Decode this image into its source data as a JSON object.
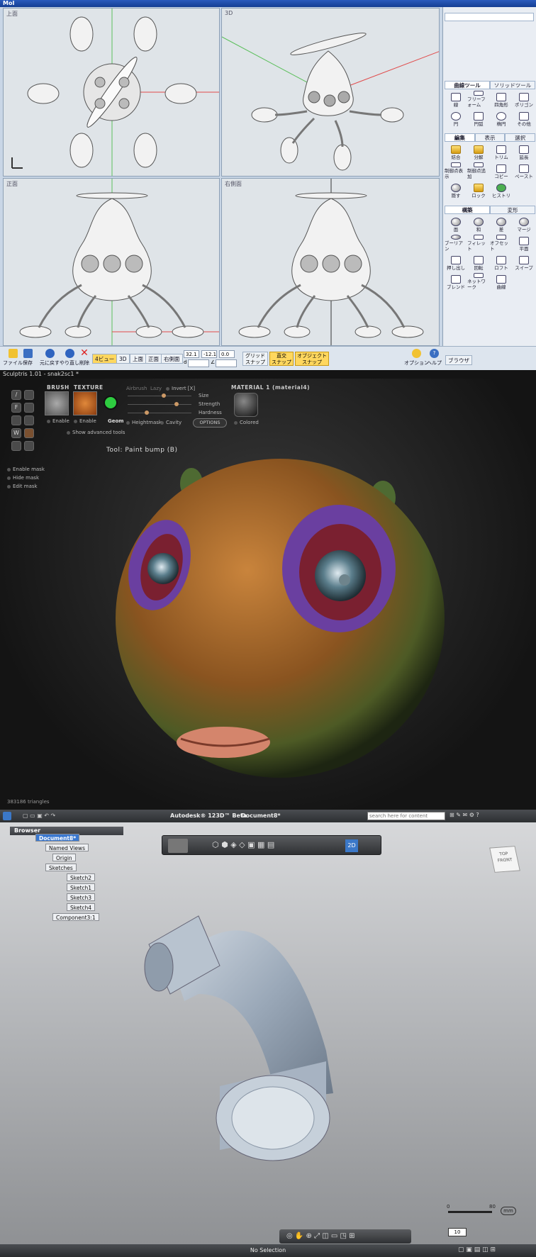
{
  "moi": {
    "title": "MoI",
    "viewports": {
      "top": "上面",
      "3d": "3D",
      "front": "正面",
      "right": "右側面"
    },
    "panel": {
      "tabs1": [
        "曲線ツール",
        "ソリッドツール"
      ],
      "curve_tools": [
        "線",
        "フリーフォーム",
        "四角形",
        "ポリゴン",
        "円",
        "円弧",
        "楕円",
        "その他"
      ],
      "tabs2": [
        "編集",
        "表示",
        "選択"
      ],
      "edit_tools": [
        "結合",
        "分解",
        "トリム",
        "延長",
        "制御点表示",
        "制御点追加",
        "コピー",
        "ペースト",
        "隠す",
        "ロック",
        "ヒストリ"
      ],
      "tabs3": [
        "構築",
        "変形"
      ],
      "build_tools": [
        "面",
        "和",
        "差",
        "マージ",
        "ブーリアン",
        "フィレット",
        "オフセット",
        "平面",
        "押し出し",
        "回転",
        "ロフト",
        "スイープ",
        "ブレンド",
        "ネットワーク",
        "曲線"
      ]
    },
    "bottom": {
      "file": "ファイル",
      "save": "保存",
      "undo": "元に戻す",
      "redo": "やり直し",
      "delete": "削除",
      "views": [
        "4ビュー",
        "3D",
        "上面",
        "正面",
        "右側面"
      ],
      "coords": [
        "32.1",
        "-12.1",
        "0.0"
      ],
      "coord_labels": [
        "d",
        "∠"
      ],
      "grid_snap": "グリッド\nスナップ",
      "straight_snap": "直交\nスナップ",
      "object_snap": "オブジェクト\nスナップ",
      "options": "オプション",
      "help": "ヘルプ",
      "browser": "ブラウザ"
    },
    "colors": {
      "accent": "#ffd75e",
      "title": "#1f4ea8"
    }
  },
  "sculptris": {
    "title": "Sculptris 1.01 - snak2sc1 *",
    "brush": "BRUSH",
    "texture": "TEXTURE",
    "airbrush": "Airbrush",
    "lazy": "Lazy",
    "invert": "Invert [X]",
    "size": "Size",
    "strength": "Strength",
    "hardness": "Hardness",
    "enable1": "Enable",
    "enable2": "Enable",
    "geom": "Geom",
    "heightmask": "Heightmask",
    "cavity": "Cavity",
    "options": "OPTIONS",
    "material": "MATERIAL 1 (material4)",
    "colored": "Colored",
    "advanced": "Show advanced tools",
    "mask": [
      "Enable mask",
      "Hide mask",
      "Edit mask"
    ],
    "tool": "Tool: Paint bump (B)",
    "triangles": "383186 triangles",
    "left_buttons": [
      "/",
      "F",
      "W"
    ]
  },
  "autodesk": {
    "app_title": "Autodesk® 123D™ Beta",
    "doc_title": "Document8*",
    "search_placeholder": "search here for content",
    "browser": "Browser",
    "tree": [
      "Document8*",
      "Named Views",
      "Origin",
      "Sketches",
      "Sketch2",
      "Sketch1",
      "Sketch3",
      "Sketch4",
      "Component3:1"
    ],
    "viewcube": [
      "TOP",
      "FRONT"
    ],
    "scale": {
      "zero": "0",
      "max": "80",
      "unit": "mm",
      "value": "10"
    },
    "status": "No Selection"
  }
}
